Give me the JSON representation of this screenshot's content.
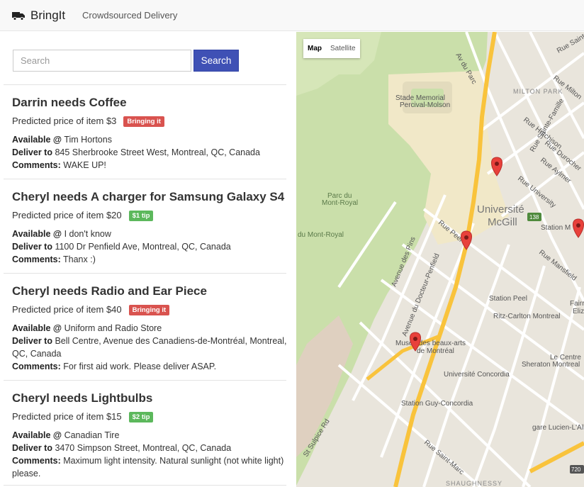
{
  "navbar": {
    "brand": "BringIt",
    "tagline": "Crowdsourced Delivery",
    "brand_icon": "truck-icon"
  },
  "search": {
    "placeholder": "Search",
    "button_label": "Search"
  },
  "requests": [
    {
      "title": "Darrin needs Coffee",
      "price_label": "Predicted price of item $3",
      "badge": "Bringing it",
      "badge_type": "bringing",
      "available_label": "Available @",
      "available_value": "Tim Hortons",
      "deliver_label": "Deliver to",
      "deliver_value": "845 Sherbrooke Street West, Montreal, QC, Canada",
      "comments_label": "Comments:",
      "comments_value": "WAKE UP!"
    },
    {
      "title": "Cheryl needs A charger for Samsung Galaxy S4",
      "price_label": "Predicted price of item $20",
      "badge": "$1 tip",
      "badge_type": "tip",
      "available_label": "Available @",
      "available_value": "I don't know",
      "deliver_label": "Deliver to",
      "deliver_value": "1100 Dr Penfield Ave, Montreal, QC, Canada",
      "comments_label": "Comments:",
      "comments_value": "Thanx :)"
    },
    {
      "title": "Cheryl needs Radio and Ear Piece",
      "price_label": "Predicted price of item $40",
      "badge": "Bringing it",
      "badge_type": "bringing",
      "available_label": "Available @",
      "available_value": "Uniform and Radio Store",
      "deliver_label": "Deliver to",
      "deliver_value": "Bell Centre, Avenue des Canadiens-de-Montréal, Montreal, QC, Canada",
      "comments_label": "Comments:",
      "comments_value": "For first aid work. Please deliver ASAP."
    },
    {
      "title": "Cheryl needs Lightbulbs",
      "price_label": "Predicted price of item $15",
      "badge": "$2 tip",
      "badge_type": "tip",
      "available_label": "Available @",
      "available_value": "Canadian Tire",
      "deliver_label": "Deliver to",
      "deliver_value": "3470 Simpson Street, Montreal, QC, Canada",
      "comments_label": "Comments:",
      "comments_value": "Maximum light intensity. Natural sunlight (not white light) please."
    }
  ],
  "map": {
    "type_buttons": [
      "Map",
      "Satellite"
    ],
    "active_type": "Map",
    "labels": {
      "milton_park": "MILTON PARK",
      "stade": "Stade Memorial",
      "percival": "Percival-Molson",
      "universite": "Université",
      "mcgill": "McGill",
      "parc": "Parc du",
      "mont_royal": "Mont-Royal",
      "du_mont_royal": "du Mont-Royal",
      "station_peel": "Station Peel",
      "ritz": "Ritz-Carlton Montreal",
      "musee1": "Musée des beaux-arts",
      "musee2": "de Montréal",
      "concordia": "Université Concordia",
      "guy": "Station Guy-Concordia",
      "centre1": "Le Centre",
      "centre2": "Sheraton Montreal",
      "lucien": "gare Lucien-L'Allier",
      "shaughnessy": "SHAUGHNESSY",
      "station_mc": "Station M",
      "fair": "Fairr",
      "eliz": "Eliz",
      "ave_pins": "Avenue des Pins",
      "ave_docteur": "Avenue du Docteur-Penfield",
      "rue_peel": "Rue Peel",
      "av_du_parc": "Av du Parc",
      "rue_hutchison": "Rue Hutchison",
      "rue_durocher": "Rue Durocher",
      "rue_aylmer": "Rue Aylmer",
      "rue_university": "Rue University",
      "rue_mansfield": "Rue Mansfield",
      "rue_milton": "Rue Milton",
      "rue_prince": "Rue Prince-Arthur",
      "rue_st_urbain": "Rue Saint-Urbain",
      "rue_sainte_famille": "Rue Sainte-Famille",
      "ave_laval": "Rue Saint-Marc",
      "st_sulpice": "St Sulpice Rd",
      "ave_atwater": "Avenue Atw",
      "route_138": "138",
      "route_720": "720"
    },
    "pins": [
      "map-pin-icon",
      "map-pin-icon",
      "map-pin-icon",
      "map-pin-icon"
    ],
    "colors": {
      "land": "#e9e5dc",
      "park": "#cadfaa",
      "campus": "#f1e8c8",
      "highway": "#f9c33c",
      "road": "#ffffff",
      "pin": "#e8413b"
    }
  }
}
